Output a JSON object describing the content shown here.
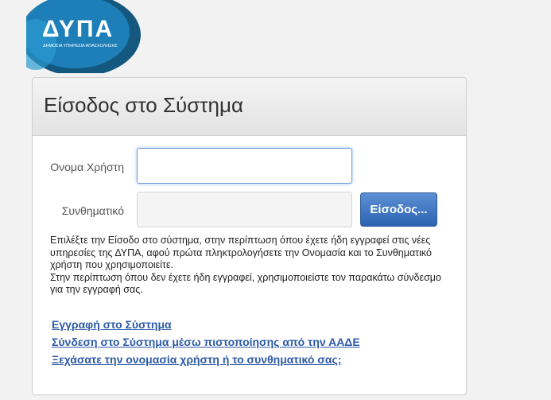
{
  "logo": {
    "text": "ΔΥΠΑ",
    "subtitle": "ΔΗΜΟΣΙΑ ΥΠΗΡΕΣΙΑ ΑΠΑΣΧΟΛΗΣΗΣ",
    "colors": {
      "primary": "#1e7fb8",
      "secondary": "#14577f"
    }
  },
  "panel": {
    "title": "Είσοδος στο Σύστημα"
  },
  "form": {
    "username_label": "Ονομα Χρήστη",
    "username_value": "",
    "password_label": "Συνθηματικό",
    "password_value": "",
    "login_button": "Είσοδος..."
  },
  "info": {
    "paragraph1": "Επιλέξτε την Είσοδο στο σύστημα, στην περίπτωση όπου έχετε ήδη εγγραφεί στις νέες υπηρεσίες της ΔΥΠΑ, αφού πρώτα πληκτρολογήσετε την Ονομασία και το Συνθηματικό χρήστη που χρησιμοποιείτε.",
    "paragraph2": "Στην περίπτωση όπου δεν έχετε ήδη εγγραφεί, χρησιμοποιείστε τον παρακάτω σύνδεσμο για την εγγραφή σας."
  },
  "links": {
    "register": "Εγγραφή στο Σύστημα",
    "aade": "Σύνδεση στο Σύστημα μέσω πιστοποίησης από την ΑΑΔΕ",
    "forgot": "Ξεχάσατε την ονομασία χρήστη ή το συνθηματικό σας;"
  },
  "theme": {
    "button": "#3a72c0",
    "link": "#2c5aa8",
    "focus_border": "#6e9ed9"
  }
}
